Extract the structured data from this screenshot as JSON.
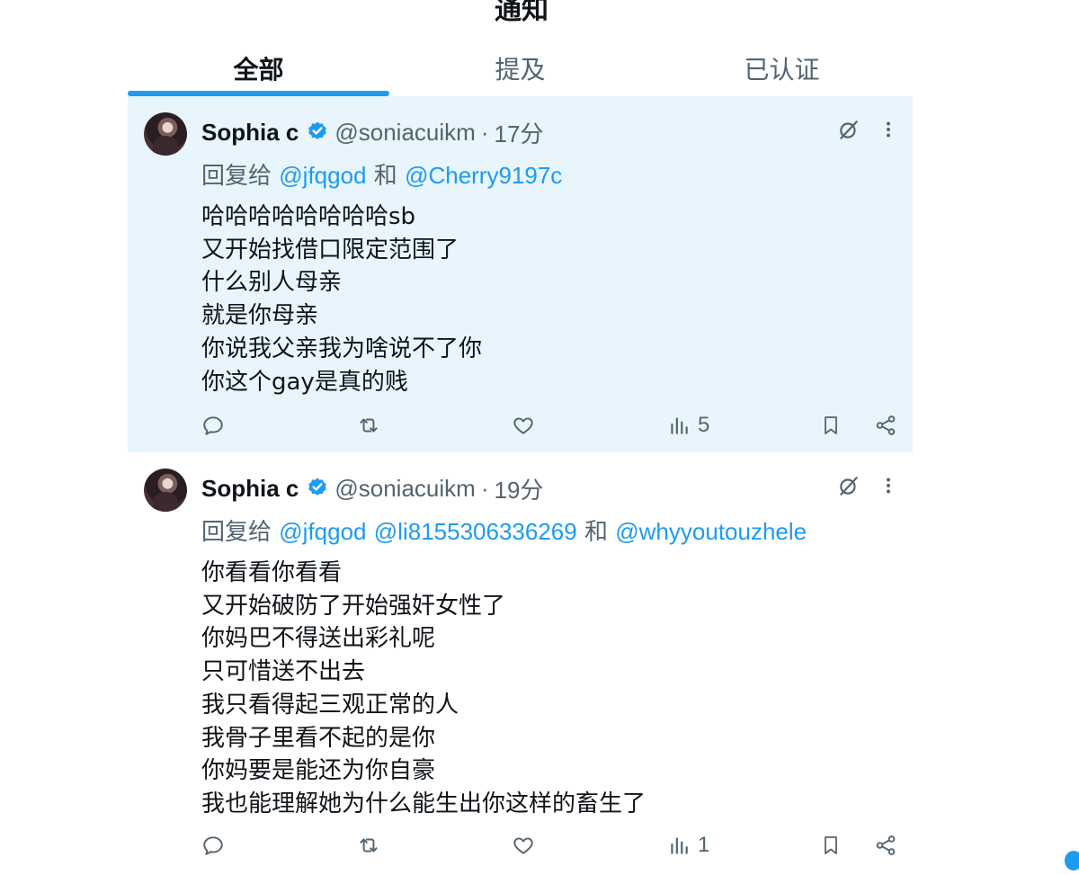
{
  "header": {
    "title": "通知"
  },
  "tabs": [
    {
      "label": "全部",
      "active": true
    },
    {
      "label": "提及",
      "active": false
    },
    {
      "label": "已认证",
      "active": false
    }
  ],
  "tweets": [
    {
      "display_name": "Sophia c",
      "handle": "@soniacuikm",
      "separator": "·",
      "time": "17分",
      "reply_prefix": "回复给",
      "mention_1": "@jfqgod",
      "conj_1": "和",
      "mention_2": "@Cherry9197c",
      "lines": [
        "哈哈哈哈哈哈哈哈sb",
        "又开始找借口限定范围了",
        "什么别人母亲",
        "就是你母亲",
        "你说我父亲我为啥说不了你",
        "你这个gay是真的贱"
      ],
      "views": "5",
      "unread": true
    },
    {
      "display_name": "Sophia c",
      "handle": "@soniacuikm",
      "separator": "·",
      "time": "19分",
      "reply_prefix": "回复给",
      "mention_1": "@jfqgod",
      "mention_2": "@li8155306336269",
      "conj_1": "和",
      "mention_3": "@whyyoutouzhele",
      "lines": [
        "你看看你看看",
        "又开始破防了开始强奸女性了",
        "你妈巴不得送出彩礼呢",
        "只可惜送不出去",
        "我只看得起三观正常的人",
        "我骨子里看不起的是你",
        "你妈要是能还为你自豪",
        "我也能理解她为什么能生出你这样的畜生了"
      ],
      "views": "1",
      "unread": false
    }
  ],
  "colors": {
    "accent": "#1d9bf0",
    "unread_bg": "#e8f5fd",
    "muted": "#536471",
    "text": "#0f1419"
  },
  "icons": [
    "verified-badge-icon",
    "grok-icon",
    "more-icon",
    "reply-icon",
    "retweet-icon",
    "like-icon",
    "views-icon",
    "bookmark-icon",
    "share-icon"
  ]
}
